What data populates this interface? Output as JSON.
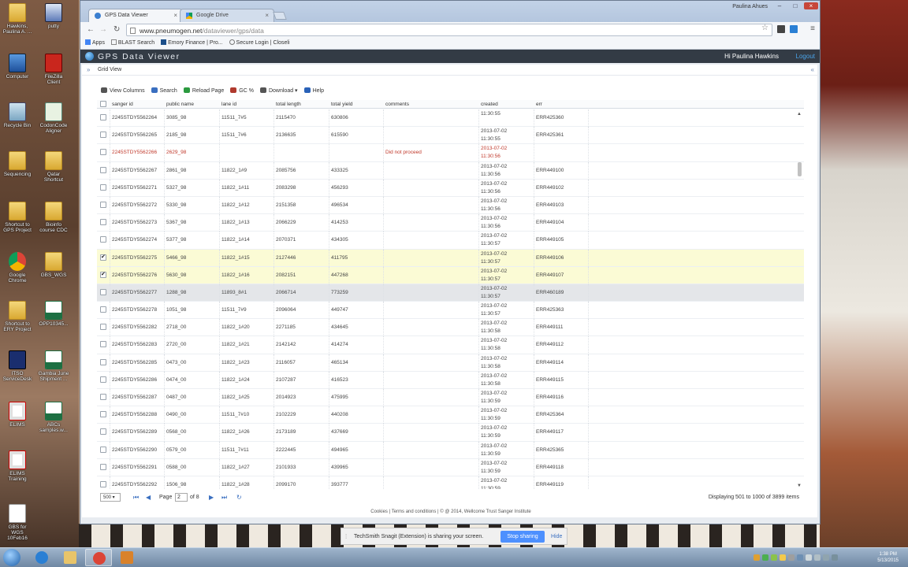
{
  "desktop": {
    "icons": [
      {
        "label": "Hawkins, Paulina A. ...",
        "icon": "folder"
      },
      {
        "label": "putty",
        "icon": "putty"
      },
      {
        "label": "Computer",
        "icon": "computer"
      },
      {
        "label": "FileZilla Client",
        "icon": "filezilla"
      },
      {
        "label": "Recycle Bin",
        "icon": "recycle"
      },
      {
        "label": "CodonCode Aligner",
        "icon": "codon"
      },
      {
        "label": "Sequencing",
        "icon": "folder"
      },
      {
        "label": "Qatar Shortcut",
        "icon": "folder"
      },
      {
        "label": "Shortcut to GPS Project",
        "icon": "folder"
      },
      {
        "label": "Bioinfo course CDC",
        "icon": "folder"
      },
      {
        "label": "Google Chrome",
        "icon": "chrome"
      },
      {
        "label": "GBS_WGS",
        "icon": "folder"
      },
      {
        "label": "Shortcut to ERY Project",
        "icon": "folder"
      },
      {
        "label": "OPP10345...",
        "icon": "excel"
      },
      {
        "label": "ITSO ServiceDesk",
        "icon": "itso"
      },
      {
        "label": "Gambia June Shipment ...",
        "icon": "excel"
      },
      {
        "label": "ELIMS",
        "icon": "elims"
      },
      {
        "label": "ABCs samples.w...",
        "icon": "excel"
      },
      {
        "label": "ELIMS Training",
        "icon": "elims"
      },
      {
        "label": "GBS for WGS 10Feb16",
        "icon": "doc"
      }
    ]
  },
  "browser": {
    "tabs": [
      {
        "label": "GPS Data Viewer",
        "active": true
      },
      {
        "label": "Google Drive",
        "active": false
      }
    ],
    "user_name": "Paulina Ahues",
    "url_host": "www.pneumogen.net",
    "url_path": "/dataviewer/gps/data",
    "bookmarks": [
      {
        "label": "Apps",
        "color": "#4285f4"
      },
      {
        "label": "BLAST Search",
        "color": "#888"
      },
      {
        "label": "Emory Finance | Pro...",
        "color": "#1a4e8a"
      },
      {
        "label": "Secure Login | Closeli",
        "color": "#777"
      }
    ]
  },
  "app": {
    "title": "GPS Data Viewer",
    "greeting": "Hi Paulina Hawkins",
    "logout": "Logout",
    "grid_title": "Grid View",
    "toolbar": [
      {
        "label": "View Columns",
        "icon": "eye-icon",
        "color": "#555"
      },
      {
        "label": "Search",
        "icon": "search-icon",
        "color": "#3a6fc0"
      },
      {
        "label": "Reload Page",
        "icon": "reload-icon",
        "color": "#2b9a3f"
      },
      {
        "label": "GC %",
        "icon": "chart-icon",
        "color": "#b03a2e"
      },
      {
        "label": "Download",
        "icon": "download-icon",
        "color": "#555"
      },
      {
        "label": "Help",
        "icon": "help-icon",
        "color": "#2a62b8"
      }
    ],
    "columns": [
      "sanger id",
      "public name",
      "lane id",
      "total length",
      "total yield",
      "comments",
      "created",
      "err"
    ],
    "rows": [
      {
        "checked": false,
        "state": "",
        "sanger_id": "2245STDY5562264",
        "public_name": "3085_98",
        "lane_id": "11511_7#5",
        "total_length": "2115470",
        "total_yield": "630806",
        "comments": "",
        "created_date": "",
        "created_time": "11:30:55",
        "err": "ERR425360"
      },
      {
        "checked": false,
        "state": "",
        "sanger_id": "2245STDY5562265",
        "public_name": "2185_98",
        "lane_id": "11511_7#6",
        "total_length": "2136635",
        "total_yield": "615590",
        "comments": "",
        "created_date": "2013-07-02",
        "created_time": "11:30:55",
        "err": "ERR425361"
      },
      {
        "checked": false,
        "state": "error",
        "sanger_id": "2245STDY5562266",
        "public_name": "2629_98",
        "lane_id": "",
        "total_length": "",
        "total_yield": "",
        "comments": "Did not proceed",
        "created_date": "2013-07-02",
        "created_time": "11:30:56",
        "err": ""
      },
      {
        "checked": false,
        "state": "",
        "sanger_id": "2245STDY5562267",
        "public_name": "2861_98",
        "lane_id": "11822_1#9",
        "total_length": "2085756",
        "total_yield": "433325",
        "comments": "",
        "created_date": "2013-07-02",
        "created_time": "11:30:56",
        "err": "ERR449100"
      },
      {
        "checked": false,
        "state": "",
        "sanger_id": "2245STDY5562271",
        "public_name": "5327_98",
        "lane_id": "11822_1#11",
        "total_length": "2083298",
        "total_yield": "456293",
        "comments": "",
        "created_date": "2013-07-02",
        "created_time": "11:30:56",
        "err": "ERR449102"
      },
      {
        "checked": false,
        "state": "",
        "sanger_id": "2245STDY5562272",
        "public_name": "5330_98",
        "lane_id": "11822_1#12",
        "total_length": "2151358",
        "total_yield": "496534",
        "comments": "",
        "created_date": "2013-07-02",
        "created_time": "11:30:56",
        "err": "ERR449103"
      },
      {
        "checked": false,
        "state": "",
        "sanger_id": "2245STDY5562273",
        "public_name": "5367_98",
        "lane_id": "11822_1#13",
        "total_length": "2066229",
        "total_yield": "414253",
        "comments": "",
        "created_date": "2013-07-02",
        "created_time": "11:30:56",
        "err": "ERR449104"
      },
      {
        "checked": false,
        "state": "",
        "sanger_id": "2245STDY5562274",
        "public_name": "5377_98",
        "lane_id": "11822_1#14",
        "total_length": "2070371",
        "total_yield": "434305",
        "comments": "",
        "created_date": "2013-07-02",
        "created_time": "11:30:57",
        "err": "ERR449105"
      },
      {
        "checked": true,
        "state": "selected",
        "sanger_id": "2245STDY5562275",
        "public_name": "5466_98",
        "lane_id": "11822_1#15",
        "total_length": "2127446",
        "total_yield": "411795",
        "comments": "",
        "created_date": "2013-07-02",
        "created_time": "11:30:57",
        "err": "ERR449106"
      },
      {
        "checked": true,
        "state": "selected",
        "sanger_id": "2245STDY5562276",
        "public_name": "5630_98",
        "lane_id": "11822_1#16",
        "total_length": "2082151",
        "total_yield": "447268",
        "comments": "",
        "created_date": "2013-07-02",
        "created_time": "11:30:57",
        "err": "ERR449107"
      },
      {
        "checked": false,
        "state": "hover",
        "sanger_id": "2245STDY5562277",
        "public_name": "1288_98",
        "lane_id": "11893_8#1",
        "total_length": "2066714",
        "total_yield": "773259",
        "comments": "",
        "created_date": "2013-07-02",
        "created_time": "11:30:57",
        "err": "ERR460189"
      },
      {
        "checked": false,
        "state": "",
        "sanger_id": "2245STDY5562278",
        "public_name": "1051_98",
        "lane_id": "11511_7#9",
        "total_length": "2096064",
        "total_yield": "449747",
        "comments": "",
        "created_date": "2013-07-02",
        "created_time": "11:30:57",
        "err": "ERR425363"
      },
      {
        "checked": false,
        "state": "",
        "sanger_id": "2245STDY5562282",
        "public_name": "2718_00",
        "lane_id": "11822_1#20",
        "total_length": "2271185",
        "total_yield": "434645",
        "comments": "",
        "created_date": "2013-07-02",
        "created_time": "11:30:58",
        "err": "ERR449111"
      },
      {
        "checked": false,
        "state": "",
        "sanger_id": "2245STDY5562283",
        "public_name": "2720_00",
        "lane_id": "11822_1#21",
        "total_length": "2142142",
        "total_yield": "414274",
        "comments": "",
        "created_date": "2013-07-02",
        "created_time": "11:30:58",
        "err": "ERR449112"
      },
      {
        "checked": false,
        "state": "",
        "sanger_id": "2245STDY5562285",
        "public_name": "0473_00",
        "lane_id": "11822_1#23",
        "total_length": "2116057",
        "total_yield": "465134",
        "comments": "",
        "created_date": "2013-07-02",
        "created_time": "11:30:58",
        "err": "ERR449114"
      },
      {
        "checked": false,
        "state": "",
        "sanger_id": "2245STDY5562286",
        "public_name": "0474_00",
        "lane_id": "11822_1#24",
        "total_length": "2107287",
        "total_yield": "416523",
        "comments": "",
        "created_date": "2013-07-02",
        "created_time": "11:30:58",
        "err": "ERR449115"
      },
      {
        "checked": false,
        "state": "",
        "sanger_id": "2245STDY5562287",
        "public_name": "0487_00",
        "lane_id": "11822_1#25",
        "total_length": "2014923",
        "total_yield": "475995",
        "comments": "",
        "created_date": "2013-07-02",
        "created_time": "11:30:59",
        "err": "ERR449116"
      },
      {
        "checked": false,
        "state": "",
        "sanger_id": "2245STDY5562288",
        "public_name": "0490_00",
        "lane_id": "11511_7#10",
        "total_length": "2102229",
        "total_yield": "440208",
        "comments": "",
        "created_date": "2013-07-02",
        "created_time": "11:30:59",
        "err": "ERR425364"
      },
      {
        "checked": false,
        "state": "",
        "sanger_id": "2245STDY5562289",
        "public_name": "0568_00",
        "lane_id": "11822_1#26",
        "total_length": "2173189",
        "total_yield": "437669",
        "comments": "",
        "created_date": "2013-07-02",
        "created_time": "11:30:59",
        "err": "ERR449117"
      },
      {
        "checked": false,
        "state": "",
        "sanger_id": "2245STDY5562290",
        "public_name": "0579_00",
        "lane_id": "11511_7#11",
        "total_length": "2222445",
        "total_yield": "494965",
        "comments": "",
        "created_date": "2013-07-02",
        "created_time": "11:30:59",
        "err": "ERR425365"
      },
      {
        "checked": false,
        "state": "",
        "sanger_id": "2245STDY5562291",
        "public_name": "0588_00",
        "lane_id": "11822_1#27",
        "total_length": "2101933",
        "total_yield": "439965",
        "comments": "",
        "created_date": "2013-07-02",
        "created_time": "11:30:59",
        "err": "ERR449118"
      },
      {
        "checked": false,
        "state": "",
        "sanger_id": "2245STDY5562292",
        "public_name": "1506_98",
        "lane_id": "11822_1#28",
        "total_length": "2099170",
        "total_yield": "393777",
        "comments": "",
        "created_date": "2013-07-02",
        "created_time": "11:30:59",
        "err": "ERR449119"
      }
    ],
    "pager": {
      "page_size": "500",
      "page_label": "Page",
      "page_value": "2",
      "of_label": "of 8",
      "summary": "Displaying 501 to 1000 of 3899 items"
    },
    "footer": "Cookies | Terms and conditions | © @ 2014, Wellcome Trust Sanger Institute"
  },
  "share_bar": {
    "message": "TechSmith Snagit (Extension) is sharing your screen.",
    "stop_label": "Stop sharing",
    "hide_label": "Hide"
  },
  "taskbar": {
    "items": [
      {
        "name": "ie",
        "color": "#2a7fd4"
      },
      {
        "name": "explorer",
        "color": "#e8c46a"
      },
      {
        "name": "chrome",
        "color": "#db4437"
      },
      {
        "name": "outlook",
        "color": "#d9822b"
      }
    ],
    "tray_colors": [
      "#e0a030",
      "#4caf50",
      "#8bc34a",
      "#f2c94c",
      "#9e9e9e",
      "#6d8fb3",
      "#cfd8dc",
      "#b0bec5",
      "#90a4ae",
      "#78909c"
    ],
    "time": "1:38 PM",
    "date": "5/13/2015"
  }
}
